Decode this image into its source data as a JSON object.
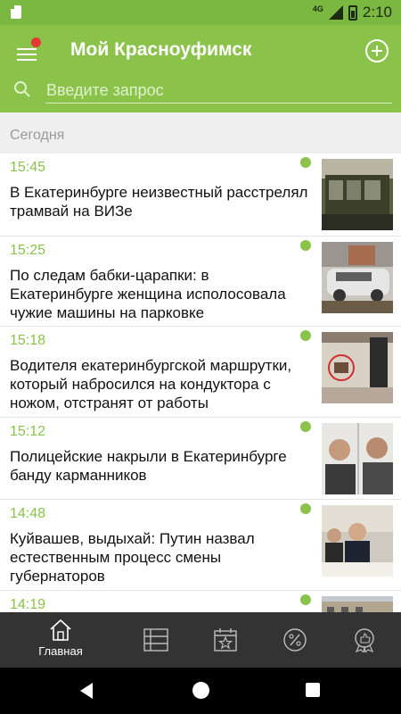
{
  "status_bar": {
    "network": "4G",
    "time": "2:10"
  },
  "header": {
    "title": "Мой Красноуфимск",
    "search_placeholder": "Введите запрос",
    "accent_color": "#8bc34a",
    "badge_color": "#e53935"
  },
  "section": {
    "label": "Сегодня"
  },
  "news": [
    {
      "time": "15:45",
      "title": "В Екатеринбурге неизвестный расстрелял трамвай на ВИЗе",
      "thumb": "tram-photo"
    },
    {
      "time": "15:25",
      "title": "По следам бабки-царапки: в Екатеринбурге женщина исполосовала чужие машины на парковке",
      "thumb": "parked-car-photo"
    },
    {
      "time": "15:18",
      "title": "Водителя екатеринбургской маршрутки, который набросился на кондуктора с ножом, отстранят от работы",
      "thumb": "bus-interior-photo"
    },
    {
      "time": "15:12",
      "title": "Полицейские накрыли в Екатеринбурге банду карманников",
      "thumb": "suspects-photo"
    },
    {
      "time": "14:48",
      "title": "Куйвашев, выдыхай: Путин назвал естественным процесс смены губернаторов",
      "thumb": "meeting-photo"
    },
    {
      "time": "14:19",
      "title": "",
      "thumb": "building-photo"
    }
  ],
  "bottom_nav": [
    {
      "icon": "home-icon",
      "label": "Главная",
      "active": true
    },
    {
      "icon": "list-icon",
      "label": ""
    },
    {
      "icon": "calendar-star-icon",
      "label": ""
    },
    {
      "icon": "percent-icon",
      "label": ""
    },
    {
      "icon": "thumbs-up-badge-icon",
      "label": ""
    }
  ]
}
